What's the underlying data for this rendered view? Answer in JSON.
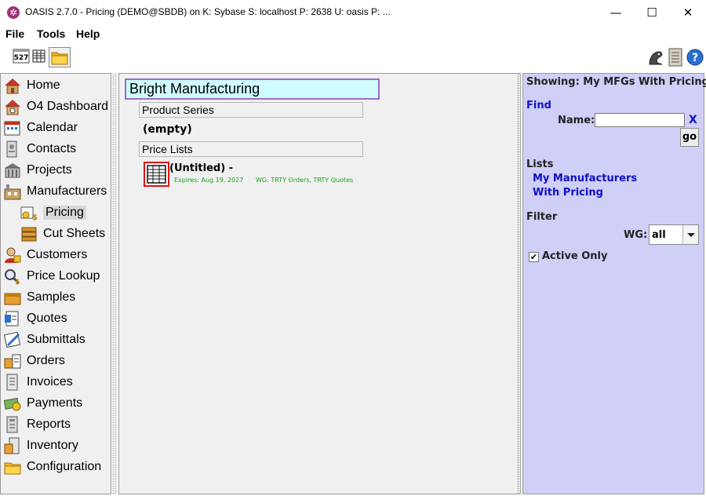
{
  "window": {
    "title": "OASIS 2.7.0 - Pricing (DEMO@SBDB) on K: Sybase  S: localhost  P: 2638  U: oasis  P: ...",
    "minimize_glyph": "—",
    "maximize_glyph": "☐",
    "close_glyph": "✕"
  },
  "menu": {
    "items": [
      "File",
      "Tools",
      "Help"
    ]
  },
  "toolbar": {
    "left_icons": [
      "calendar-527-icon",
      "grid-icon",
      "folder-icon"
    ],
    "calendar_text": "527",
    "right_icons": [
      "dragon-icon",
      "book-icon",
      "help-icon"
    ],
    "help_glyph": "?"
  },
  "sidebar": {
    "items": [
      {
        "label": "Home",
        "icon": "home-icon"
      },
      {
        "label": "O4 Dashboard",
        "icon": "dashboard-icon"
      },
      {
        "label": "Calendar",
        "icon": "calendar-icon"
      },
      {
        "label": "Contacts",
        "icon": "contacts-icon"
      },
      {
        "label": "Projects",
        "icon": "projects-icon"
      },
      {
        "label": "Manufacturers",
        "icon": "manufacturers-icon"
      },
      {
        "label": "Pricing",
        "icon": "pricing-icon"
      },
      {
        "label": "Cut Sheets",
        "icon": "cut-sheets-icon"
      },
      {
        "label": "Customers",
        "icon": "customers-icon"
      },
      {
        "label": "Price Lookup",
        "icon": "price-lookup-icon"
      },
      {
        "label": "Samples",
        "icon": "samples-icon"
      },
      {
        "label": "Quotes",
        "icon": "quotes-icon"
      },
      {
        "label": "Submittals",
        "icon": "submittals-icon"
      },
      {
        "label": "Orders",
        "icon": "orders-icon"
      },
      {
        "label": "Invoices",
        "icon": "invoices-icon"
      },
      {
        "label": "Payments",
        "icon": "payments-icon"
      },
      {
        "label": "Reports",
        "icon": "reports-icon"
      },
      {
        "label": "Inventory",
        "icon": "inventory-icon"
      },
      {
        "label": "Configuration",
        "icon": "configuration-icon"
      }
    ],
    "selected": "Pricing"
  },
  "main": {
    "manufacturer": "Bright Manufacturing",
    "product_series_header": "Product Series",
    "product_series_empty": "(empty)",
    "price_lists_header": "Price Lists",
    "price_list": {
      "name": "(Untitled) -",
      "expires": "Expires: Aug 19, 2027",
      "wg": "WG: TRTY Orders, TRTY Quotes"
    }
  },
  "right_panel": {
    "showing": "Showing: My MFGs With Pricing",
    "find_header": "Find",
    "name_label": "Name:",
    "name_value": "",
    "clear_label": "X",
    "go_label": "go",
    "lists_header": "Lists",
    "lists": [
      "My Manufacturers",
      "With Pricing"
    ],
    "filter_header": "Filter",
    "wg_label": "WG:",
    "wg_value": "all",
    "active_only_label": "Active Only",
    "active_only_checked": true,
    "check_glyph": "✔"
  },
  "colors": {
    "right_panel_bg": "#cfcff7",
    "link": "#1010c8",
    "mfg_title_bg": "#cffcff",
    "accent_green": "#1aa31a",
    "selection_red": "#e01010"
  }
}
